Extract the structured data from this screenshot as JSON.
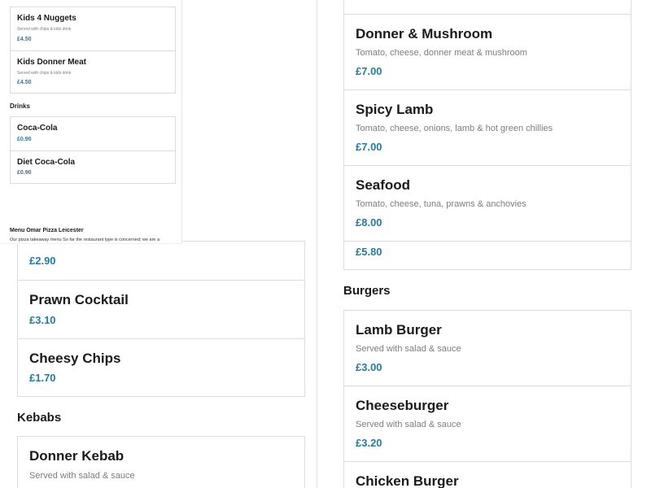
{
  "overlay": {
    "kids_items": [
      {
        "name": "Kids 4 Nuggets",
        "desc": "Served with chips & kids drink",
        "price": "£4.50"
      },
      {
        "name": "Kids Donner Meat",
        "desc": "Served with chips & kids drink",
        "price": "£4.50"
      }
    ],
    "drinks_title": "Drinks",
    "drinks_items": [
      {
        "name": "Coca-Cola",
        "price": "£0.90"
      },
      {
        "name": "Diet Coca-Cola",
        "price": "£0.90"
      }
    ],
    "footer_title": "Menu Omar Pizza Leicester",
    "footer_text": "Our pizza takeaway menu  So far the restaurant type is concerned; we are a"
  },
  "left": {
    "sides_items": [
      {
        "name": "",
        "price": "£2.90"
      },
      {
        "name": "Prawn Cocktail",
        "price": "£3.10"
      },
      {
        "name": "Cheesy Chips",
        "price": "£1.70"
      }
    ],
    "kebabs_title": "Kebabs",
    "kebabs_items": [
      {
        "name": "Donner Kebab",
        "desc": "Served with salad & sauce",
        "price": ""
      }
    ]
  },
  "right": {
    "pizza_items": [
      {
        "name": "Donner & Mushroom",
        "desc": "Tomato, cheese, donner meat & mushroom",
        "price": "£7.00"
      },
      {
        "name": "Spicy Lamb",
        "desc": "Tomato, cheese, onions, lamb & hot green chillies",
        "price": "£7.00"
      },
      {
        "name": "Seafood",
        "desc": "Tomato, cheese, tuna, prawns & anchovies",
        "price": "£8.00"
      }
    ],
    "other_price": "£5.80",
    "burgers_title": "Burgers",
    "burger_items": [
      {
        "name": "Lamb Burger",
        "desc": "Served with salad & sauce",
        "price": "£3.00"
      },
      {
        "name": "Cheeseburger",
        "desc": "Served with salad & sauce",
        "price": "£3.20"
      },
      {
        "name": "Chicken Burger",
        "desc": "",
        "price": ""
      }
    ]
  },
  "colors": {
    "price": "#2a7a9b",
    "border": "#dcdcdc",
    "desc": "#7d7d7d"
  }
}
